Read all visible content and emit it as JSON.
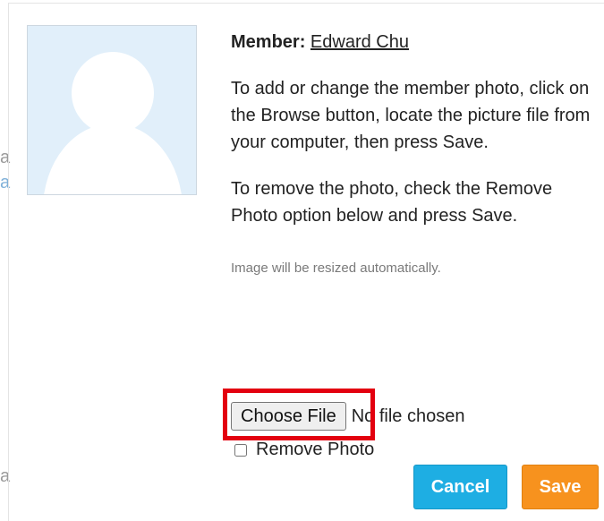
{
  "member": {
    "label": "Member:",
    "name": "Edward Chu"
  },
  "instructions": {
    "add_change": "To add or change the member photo, click on the Browse button, locate the picture file from your computer, then press Save.",
    "remove": "To remove the photo, check the Remove Photo option below and press Save.",
    "resize_note": "Image will be resized automatically."
  },
  "file_input": {
    "button_label": "Choose File",
    "status": "No file chosen"
  },
  "remove_photo": {
    "label": "Remove Photo",
    "checked": false
  },
  "actions": {
    "cancel_label": "Cancel",
    "save_label": "Save"
  },
  "backdrop": {
    "char_1": "a",
    "char_2": "a",
    "char_3": "a"
  },
  "colors": {
    "avatar_bg": "#e1effa",
    "cancel": "#1eaee3",
    "save": "#f7921e",
    "highlight": "#e3000f"
  },
  "icons": {
    "avatar": "person-silhouette-icon"
  }
}
